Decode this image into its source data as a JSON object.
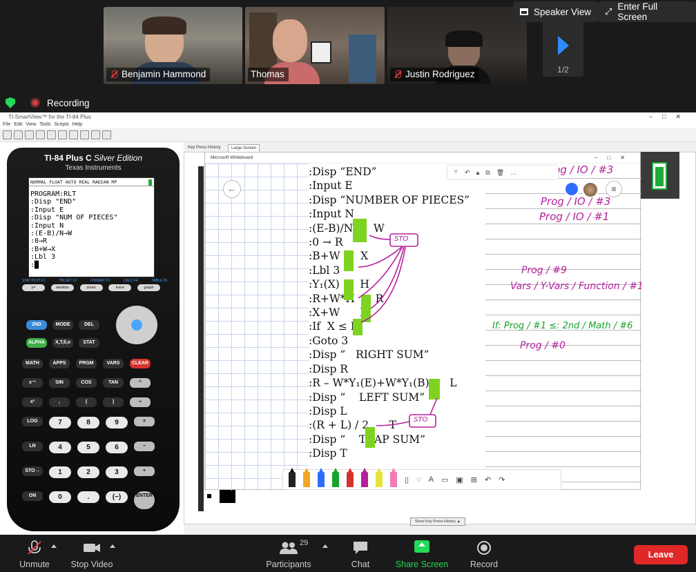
{
  "participants": [
    {
      "name": "Benjamin Hammond",
      "muted": true
    },
    {
      "name": "Thomas",
      "muted": false
    },
    {
      "name": "Justin Rodriguez",
      "muted": true
    }
  ],
  "top_controls": {
    "speaker_view": "Speaker View",
    "full_screen": "Enter Full Screen"
  },
  "pager": {
    "count": "1/2"
  },
  "recording": {
    "label": "Recording"
  },
  "app": {
    "title": "TI-SmartView™ for the TI-84 Plus",
    "menu": "File  Edit  View  Tools  Scripts  Help",
    "tabs": [
      "Key Press History",
      "Large Screen"
    ],
    "show_history": "Show Key Press History ▲"
  },
  "calculator": {
    "brand": "TI-84 Plus C",
    "edition": "Silver Edition",
    "maker": "Texas Instruments",
    "status": "NORMAL FLOAT AUTO REAL RADIAN MP",
    "lines": [
      "PROGRAM:RLT",
      ":Disp \"END\"",
      ":Input E",
      ":Disp \"NUM OF PIECES\"",
      ":Input N",
      ":(E-B)/N→W",
      ":0→R",
      ":B+W→X",
      ":Lbl 3",
      ":█"
    ],
    "fkeys": [
      "y=",
      "window",
      "zoom",
      "trace",
      "graph"
    ],
    "flabels": [
      "STAT PLOT F1",
      "TBLSET F2",
      "FORMAT F3",
      "CALC F4",
      "TABLE F5"
    ],
    "row1": [
      "2ND",
      "MODE",
      "DEL"
    ],
    "row2": [
      "ALPHA",
      "X,T,θ,n",
      "STAT"
    ],
    "row3": [
      "MATH",
      "APPS",
      "PRGM",
      "VARS",
      "CLEAR"
    ],
    "row4": [
      "x⁻¹",
      "SIN",
      "COS",
      "TAN",
      "^"
    ],
    "row5": [
      "x²",
      ",",
      "(",
      ")",
      "÷"
    ],
    "row6": [
      "LOG",
      "7",
      "8",
      "9",
      "×"
    ],
    "row7": [
      "LN",
      "4",
      "5",
      "6",
      "−"
    ],
    "row8": [
      "STO→",
      "1",
      "2",
      "3",
      "+"
    ],
    "row9": [
      "ON",
      "0",
      ".",
      "(−)",
      "ENTER"
    ]
  },
  "whiteboard": {
    "title": "Microsoft Whiteboard",
    "program_lines": [
      ":Disp “END”",
      ":Input E",
      ":Disp “NUMBER OF PIECES”",
      ":Input N",
      ":(E-B)/N      W",
      ":0 → R",
      ":B+W      X",
      ":Lbl 3",
      ":Y₁(X)      H",
      ":R+W*H      R",
      ":X+W      X",
      ":If  X ≤ E",
      ":Goto 3",
      ":Disp “   RIGHT SUM”",
      ":Disp R",
      ":R – W*Y₁(E)+W*Y₁(B)      L",
      ":Disp “    LEFT SUM”",
      ":Disp L",
      ":(R + L) / 2      T",
      ":Disp “    TRAP SUM”",
      ":Disp T"
    ],
    "notes": [
      {
        "text": "Prog / IO / #3",
        "color": "#b4219b"
      },
      {
        "text": "Prog / IO / #3",
        "color": "#b4219b"
      },
      {
        "text": "Prog / IO / #1",
        "color": "#b4219b"
      },
      {
        "text": "Prog / #9",
        "color": "#b4219b"
      },
      {
        "text": "Vars / Y-Vars / Function / #1",
        "color": "#b4219b"
      },
      {
        "text": "If: Prog / #1     ≤: 2nd / Math / #6",
        "color": "#17a32b"
      },
      {
        "text": "Prog / #0",
        "color": "#b4219b"
      }
    ],
    "sto_labels": [
      "STO",
      "STO"
    ]
  },
  "bottom": {
    "unmute": "Unmute",
    "stop_video": "Stop Video",
    "participants": "Participants",
    "participant_count": "29",
    "chat": "Chat",
    "share_screen": "Share Screen",
    "record": "Record",
    "leave": "Leave"
  },
  "colors": {
    "accent_blue": "#2d8cff",
    "active_green": "#23d959",
    "leave_red": "#e02828",
    "ink_magenta": "#b4219b",
    "highlight_green": "#7ed321"
  }
}
